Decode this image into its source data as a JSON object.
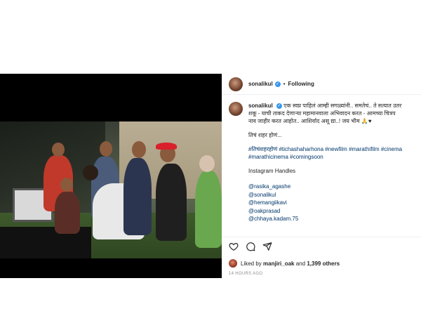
{
  "post": {
    "username": "sonalikul",
    "follow_status": "Following",
    "caption": {
      "lines": [
        "एक स्वप्न पाहिलं आम्ही सगळ्यांनी.. समतेचं.. ते सत्यात उतर",
        "शकू - याची ताकद देणाऱ्या महामानवाला अभिवादन करत - आमच्या चित्रप",
        "नाव जाहीर करत आहोत.. आशिर्वाद असू द्या..! जय भीम"
      ],
      "emoji_tail": "🙏♥",
      "subtitle": "तिचं शहर होणं...",
      "hashtags_line1": "#तिचंशहरहोणं #tichashaharhona #newfilm #marathifilm #cinema",
      "hashtags_line2": "#marathicinema #comingsoon",
      "handles_title": "Instagram Handles",
      "handles": [
        "@rasika_agashe",
        "@sonalikul",
        "@hemangiikavi",
        "@oakprasad",
        "@chhaya.kadam.75"
      ]
    },
    "likes": {
      "prefix": "Liked by",
      "first_user": "manjiri_oak",
      "joiner": "and",
      "others": "1,399 others"
    },
    "timestamp": "14 HOURS AGO"
  },
  "icons": {
    "verified": "verified-badge-icon",
    "like": "heart-icon",
    "comment": "comment-icon",
    "share": "share-icon"
  },
  "colors": {
    "link": "#00376b",
    "verified": "#3897f0",
    "muted": "#8e8e8e"
  }
}
